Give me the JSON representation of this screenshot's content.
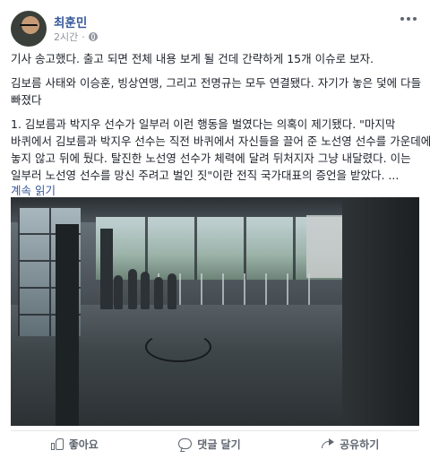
{
  "post": {
    "author": "최훈민",
    "time": "2시간",
    "privacy_icon": "globe-icon",
    "paragraphs": [
      [
        "기사 송고했다. 출고 되면 전체 내용 보게 될 건데 간략하게 15개 이슈로 보자."
      ],
      [
        "김보름 사태와 이승훈, 빙상연맹, 그리고 전명규는 모두 연결됐다. 자기가 놓은 덫에 다들",
        "빠졌다"
      ],
      [
        "1. 김보름과 박지우 선수가 일부러 이런 행동을 벌였다는 의혹이 제기됐다. \"마지막",
        "바퀴에서 김보름과 박지우 선수는 직전 바퀴에서 자신들을 끌어 준 노선영 선수를 가운데에",
        "놓지 않고 뒤에 뒀다. 탈진한 노선영 선수가 체력에 달려 뒤처지자 그냥 내달렸다. 이는",
        "일부러 노선영 선수를 망신 주려고 벌인 짓\"이란 전직 국가대표의 증언을 받았다. ..."
      ]
    ],
    "see_more": "계속 읽기"
  },
  "actions": {
    "like": "좋아요",
    "comment": "댓글 달기",
    "share": "공유하기"
  }
}
